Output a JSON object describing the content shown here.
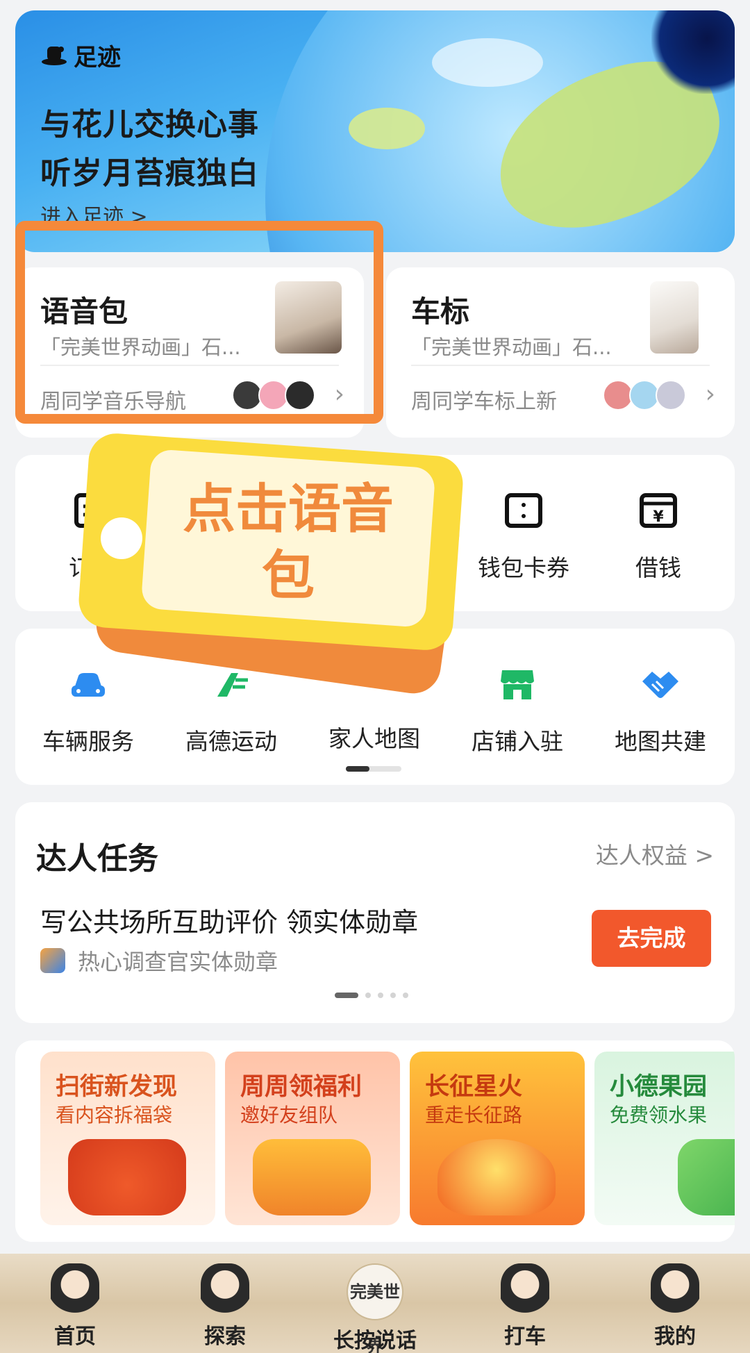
{
  "hero": {
    "tag": "足迹",
    "line1": "与花儿交换心事",
    "line2": "听岁月苔痕独白",
    "link": "进入足迹 >"
  },
  "voice_card": {
    "title": "语音包",
    "subtitle": "「完美世界动画」石...",
    "footer": "周同学音乐导航"
  },
  "car_card": {
    "title": "车标",
    "subtitle": "「完美世界动画」石...",
    "footer": "周同学车标上新"
  },
  "row1": {
    "items": [
      {
        "label": "订单",
        "icon": "order-icon"
      },
      {
        "label": "钱包卡券",
        "icon": "wallet-card-icon"
      },
      {
        "label": "借钱",
        "icon": "loan-icon"
      }
    ]
  },
  "row2": {
    "items": [
      {
        "label": "车辆服务",
        "icon": "car-icon"
      },
      {
        "label": "高德运动",
        "icon": "run-icon"
      },
      {
        "label": "家人地图",
        "icon": "family-map-icon"
      },
      {
        "label": "店铺入驻",
        "icon": "shop-icon"
      },
      {
        "label": "地图共建",
        "icon": "handshake-icon"
      }
    ]
  },
  "sticker": {
    "text": "点击语音包"
  },
  "task": {
    "heading": "达人任务",
    "more": "达人权益 >",
    "title": "写公共场所互助评价 领实体勋章",
    "reward": "热心调查官实体勋章",
    "button": "去完成"
  },
  "promos": [
    {
      "title": "扫街新发现",
      "subtitle": "看内容拆福袋"
    },
    {
      "title": "周周领福利",
      "subtitle": "邀好友组队"
    },
    {
      "title": "长征星火",
      "subtitle": "重走长征路"
    },
    {
      "title": "小德果园",
      "subtitle": "免费领水果"
    }
  ],
  "tabbar": {
    "items": [
      {
        "label": "首页"
      },
      {
        "label": "探索"
      },
      {
        "label": "长按说话",
        "center_mark": "完美世界"
      },
      {
        "label": "打车"
      },
      {
        "label": "我的"
      }
    ]
  },
  "colors": {
    "highlight": "#f5893a",
    "cta": "#f2582c",
    "car_icon": "#2d8cf0",
    "shop_icon": "#1fb866"
  }
}
